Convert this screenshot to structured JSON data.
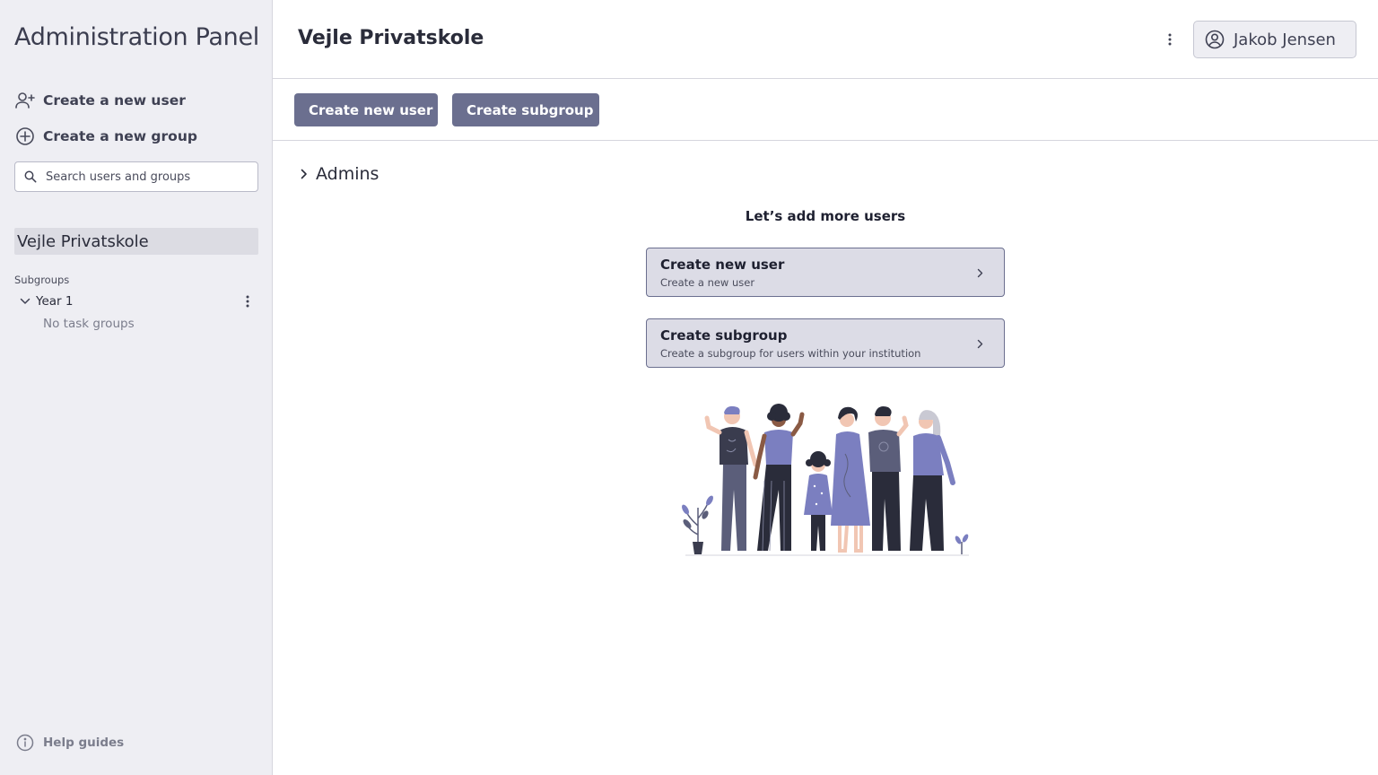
{
  "sidebar": {
    "app_title": "Administration Panel",
    "actions": [
      {
        "label": "Create a new user",
        "icon": "user-plus-icon"
      },
      {
        "label": "Create a new group",
        "icon": "circle-plus-icon"
      }
    ],
    "search": {
      "placeholder": "Search users and groups",
      "value": ""
    },
    "selected_org": "Vejle Privatskole",
    "subgroups_label": "Subgroups",
    "tree": [
      {
        "label": "Year 1",
        "expanded": true,
        "empty_text": "No task groups"
      }
    ],
    "help_label": "Help guides"
  },
  "header": {
    "title": "Vejle Privatskole",
    "user_name": "Jakob Jensen"
  },
  "toolbar": {
    "create_user_label": "Create new user",
    "create_subgroup_label": "Create subgroup"
  },
  "main": {
    "admins_label": "Admins",
    "empty_heading": "Let’s add more users",
    "cards": [
      {
        "title": "Create new user",
        "description": "Create a new user"
      },
      {
        "title": "Create subgroup",
        "description": "Create a subgroup for users within your institution"
      }
    ]
  },
  "colors": {
    "accent": "#6b6f8f",
    "sidebar_bg": "#eeeef3",
    "card_bg": "#dcdce6",
    "illustration_primary": "#7b7fc0",
    "illustration_dark": "#3a3c4e"
  }
}
